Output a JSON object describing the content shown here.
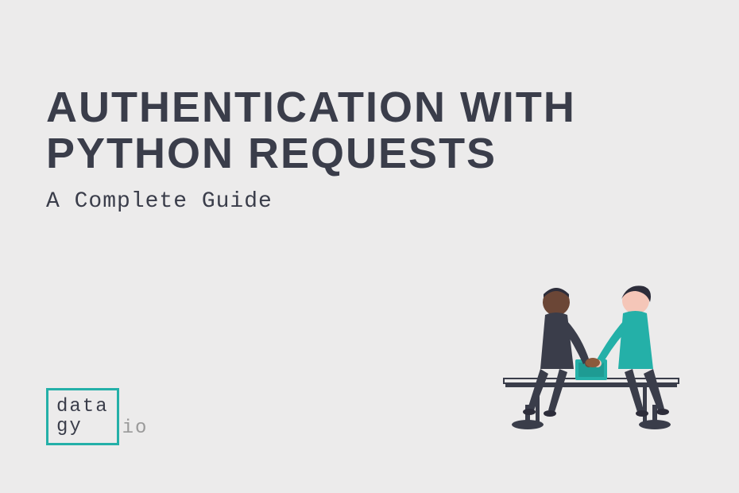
{
  "heading_line1": "AUTHENTICATION WITH",
  "heading_line2": "PYTHON REQUESTS",
  "subtitle": "A Complete Guide",
  "logo": {
    "line1": "data",
    "line2": "gy",
    "suffix": "io"
  },
  "illustration_alt": "Two people shaking hands across a table with a laptop",
  "colors": {
    "background": "#ecebeb",
    "text": "#3a3d4a",
    "accent": "#24b0a8",
    "muted": "#9a9a9a"
  }
}
